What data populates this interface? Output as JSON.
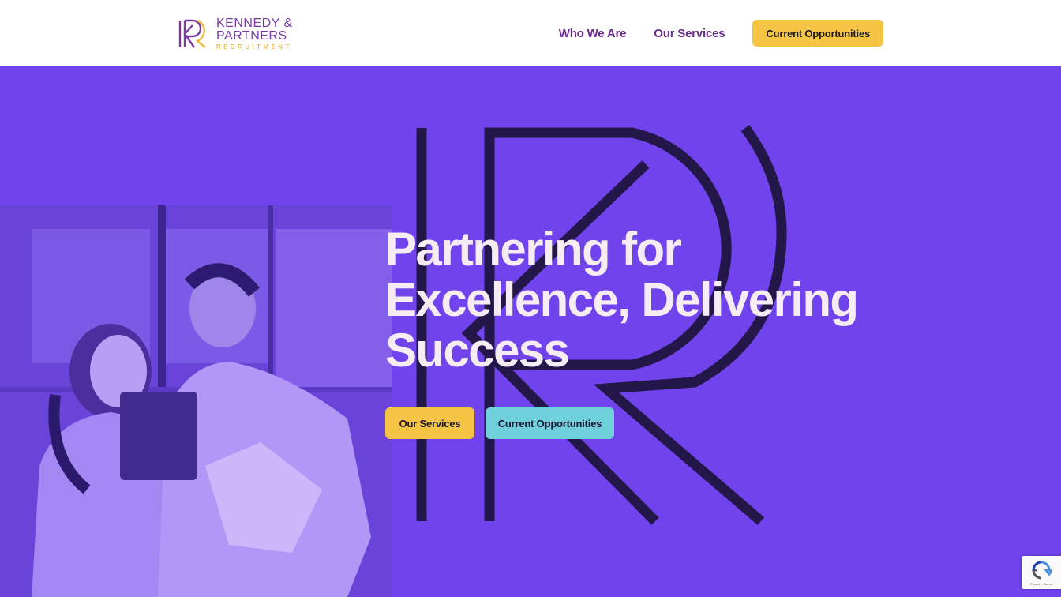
{
  "brand": {
    "line1": "KENNEDY &",
    "line2": "PARTNERS",
    "line3": "RECRUITMENT",
    "colors": {
      "purple": "#7a3aa6",
      "gold": "#d9a92a"
    }
  },
  "nav": {
    "links": [
      "Who We Are",
      "Our Services"
    ],
    "cta": "Current Opportunities"
  },
  "hero": {
    "title_lines": [
      "Partnering for",
      "Excellence, Delivering",
      "Success"
    ],
    "buttons": {
      "primary": "Our Services",
      "secondary": "Current Opportunities"
    }
  },
  "recaptcha": {
    "text": "Privacy - Terms",
    "icon": "recaptcha-icon"
  },
  "colors": {
    "hero_bg": "#7043ec",
    "yellow": "#f5c445",
    "teal": "#6fd0dc",
    "title": "#f6ecf4",
    "outline_mark": "#221748"
  }
}
